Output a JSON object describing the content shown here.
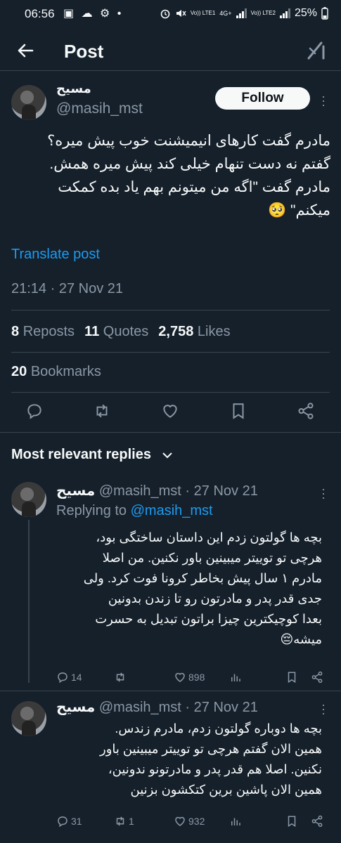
{
  "status": {
    "time": "06:56",
    "left_icons": "▣ ☁ ⚙ •",
    "net1": "Vo)) LTE1",
    "net1_type": "4G+",
    "net2": "Vo)) LTE2",
    "battery": "25%"
  },
  "header": {
    "title": "Post"
  },
  "post": {
    "name": "مسیح",
    "handle": "@masih_mst",
    "follow_label": "Follow",
    "text_lines": [
      "مادرم گفت کارهای انیمیشنت خوب پیش میره؟",
      "گفتم نه دست تنهام خیلی کند پیش میره همش.",
      "مادرم گفت \"اگه من میتونم بهم یاد بده کمکت",
      "میکنم\" 🥺"
    ],
    "translate": "Translate post",
    "timestamp": "21:14 · 27 Nov 21",
    "reposts_count": "8",
    "reposts_label": "Reposts",
    "quotes_count": "11",
    "quotes_label": "Quotes",
    "likes_count": "2,758",
    "likes_label": "Likes",
    "bookmarks_count": "20",
    "bookmarks_label": "Bookmarks"
  },
  "replies_header": "Most relevant replies",
  "replies": [
    {
      "name": "مسیح",
      "handle": "@masih_mst · 27 Nov 21",
      "replying_prefix": "Replying to ",
      "replying_to": "@masih_mst",
      "text_lines": [
        "بچه ها گولتون زدم این داستان ساختگی بود،",
        "هرچی تو توییتر میبینین باور نکنین. من اصلا",
        "مادرم ۱ سال پیش بخاطر کرونا فوت کرد. ولی",
        "جدی قدر پدر و مادرتون رو تا زندن بدونین",
        "بعدا کوچیکترین چیزا براتون تبدیل به حسرت",
        "میشه😔"
      ],
      "replies_count": "14",
      "reposts_count": "",
      "likes_count": "898"
    },
    {
      "name": "مسیح",
      "handle": "@masih_mst · 27 Nov 21",
      "text_lines": [
        "بچه ها دوباره گولتون زدم، مادرم زندس.",
        "همین الان گفتم هرچی تو توییتر میبینین باور",
        "نکنین. اصلا هم قدر پدر و مادرتونو ندونین،",
        "همین الان پاشین برین کتکشون بزنین"
      ],
      "replies_count": "31",
      "reposts_count": "1",
      "likes_count": "932"
    }
  ],
  "colors": {
    "background": "#15202b",
    "accent": "#1d9bf0",
    "muted": "#8b98a5",
    "divider": "#38444d"
  }
}
